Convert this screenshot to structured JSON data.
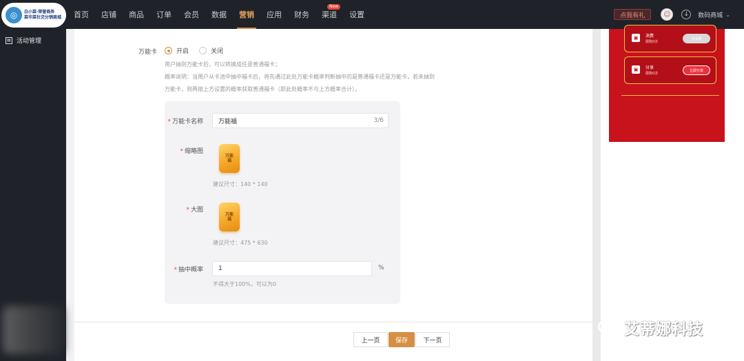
{
  "logo": {
    "line1": "白小菜·荣誉商务",
    "line2": "菜华菜社交分销商城"
  },
  "nav": {
    "items": [
      "首页",
      "店铺",
      "商品",
      "订单",
      "会员",
      "数据",
      "营销",
      "应用",
      "财务",
      "渠道",
      "设置"
    ],
    "active_index": 6,
    "new_badge": "New"
  },
  "topbar": {
    "action_button": "点我有礼",
    "store_name": "数码商城"
  },
  "sidebar": {
    "item": "活动管理"
  },
  "form": {
    "wildcard_label": "万能卡",
    "on_label": "开启",
    "off_label": "关闭",
    "desc1": "用户抽到万能卡后，可以转换成任意普通福卡；",
    "desc2": "概率说明：当用户从卡池中抽中福卡后，将先通过此处万能卡概率判断抽中的是普通福卡还是万能卡，若未抽到",
    "desc3": "万能卡，则再按上方设置的概率获取普通福卡（即此处概率不与上方概率合计）。",
    "name_label": "万能卡名称",
    "name_value": "万能福",
    "name_counter": "3/6",
    "thumb_label": "缩略图",
    "thumb_text": "万能福",
    "thumb_hint": "建议尺寸：140 * 140",
    "big_label": "大图",
    "big_text": "万能福",
    "big_hint": "建议尺寸：475 * 630",
    "rate_label": "抽中概率",
    "rate_value": "1",
    "rate_unit": "%",
    "rate_hint": "不得大于100%，可以为0"
  },
  "footer": {
    "prev": "上一页",
    "save": "保存",
    "next": "下一页"
  },
  "preview": {
    "task1_title": "消费",
    "task1_sub": "限购0次",
    "task1_btn": "去消费",
    "task2_title": "分享",
    "task2_sub": "限购0次",
    "task2_btn": "立即分享"
  },
  "watermark": "艾蒂娜科技"
}
